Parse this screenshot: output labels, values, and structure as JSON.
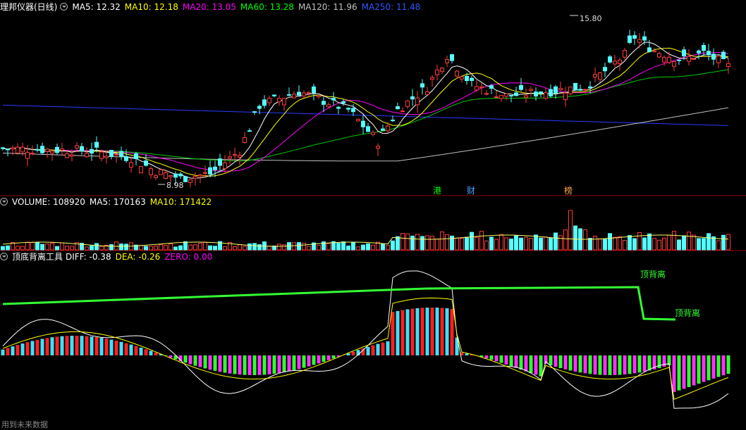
{
  "price_panel": {
    "title": "理邦仪器(日线)",
    "indicators": [
      {
        "label": "MA5: 12.32",
        "color": "#ffffff"
      },
      {
        "label": "MA10: 12.18",
        "color": "#ffff00"
      },
      {
        "label": "MA20: 13.05",
        "color": "#ff00ff"
      },
      {
        "label": "MA60: 13.28",
        "color": "#00ff00"
      },
      {
        "label": "MA120: 11.96",
        "color": "#c0c0c0"
      },
      {
        "label": "MA250: 11.48",
        "color": "#3355ff"
      }
    ],
    "high_label": "15.80",
    "low_label": "8.98",
    "markers": [
      {
        "label": "港",
        "color": "#00ff00"
      },
      {
        "label": "财",
        "color": "#4aa0ff"
      },
      {
        "label": "榜",
        "color": "#ffaa44"
      }
    ]
  },
  "volume_panel": {
    "indicators": [
      {
        "label": "VOLUME: 108920",
        "color": "#ffffff"
      },
      {
        "label": "MA5: 170163",
        "color": "#ffffff"
      },
      {
        "label": "MA10: 171422",
        "color": "#ffff00"
      }
    ]
  },
  "macd_panel": {
    "title": "顶底背离工具",
    "indicators": [
      {
        "label": "DIFF: -0.38",
        "color": "#ffffff"
      },
      {
        "label": "DEA: -0.26",
        "color": "#ffff00"
      },
      {
        "label": "ZERO: 0.00",
        "color": "#ff00ff"
      }
    ],
    "annotations": [
      "顶背离",
      "顶背离"
    ]
  },
  "footer": "用到未来数据",
  "chart_data": [
    {
      "type": "candlestick",
      "title": "理邦仪器(日线)",
      "high": 15.8,
      "low": 8.98,
      "series": [
        {
          "name": "MA5",
          "value": 12.32
        },
        {
          "name": "MA10",
          "value": 12.18
        },
        {
          "name": "MA20",
          "value": 13.05
        },
        {
          "name": "MA60",
          "value": 13.28
        },
        {
          "name": "MA120",
          "value": 11.96
        },
        {
          "name": "MA250",
          "value": 11.48
        }
      ]
    },
    {
      "type": "bar",
      "series": [
        {
          "name": "VOLUME",
          "value": 108920
        },
        {
          "name": "MA5",
          "value": 170163
        },
        {
          "name": "MA10",
          "value": 171422
        }
      ]
    },
    {
      "type": "bar",
      "title": "顶底背离工具",
      "series": [
        {
          "name": "DIFF",
          "value": -0.38
        },
        {
          "name": "DEA",
          "value": -0.26
        },
        {
          "name": "ZERO",
          "value": 0.0
        }
      ]
    }
  ]
}
